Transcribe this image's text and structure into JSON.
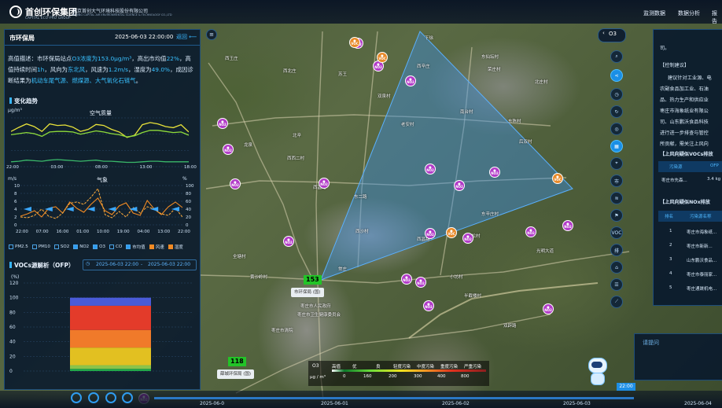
{
  "header": {
    "logo_text": "首创环保集团",
    "logo_sub": "CAPITAL ECO-PRO GROUP",
    "company_cn": "北京首创大气环境科技股份有限公司",
    "company_sub": "BEIJING CAPITAL AIR ENVIRONMENTAL SCIENCE & TECHNOLOGY CO.,LTD",
    "nav": [
      "监测数据",
      "数据分析",
      "报告"
    ]
  },
  "left_panel": {
    "title": "市环保局",
    "time": "2025-06-03 22:00:00",
    "back_label": "返回",
    "desc_parts": [
      "高值描述：市环保局站点",
      "O3浓度为153.0μg/m³",
      "，高出市均值",
      "22%",
      "，高值持续时间",
      "1h",
      "，风向为",
      "东北风",
      "，风速为",
      "1.2m/s",
      "，湿度为",
      "49.0%",
      "，成因诊断结果为",
      "机动车尾气源、燃煤源、大气氧化石链气",
      "。"
    ],
    "trend_title": "变化趋势",
    "aq_chart_title": "空气质量",
    "aq_unit": "μg/m³",
    "met_chart_title": "气象",
    "met_unit_left": "m/s",
    "met_unit_right": "%",
    "legend": [
      {
        "label": "PM2.5",
        "checked": false
      },
      {
        "label": "PM10",
        "checked": false
      },
      {
        "label": "SO2",
        "checked": false
      },
      {
        "label": "NO2",
        "checked": true
      },
      {
        "label": "O3",
        "checked": true
      },
      {
        "label": "CO",
        "checked": false
      },
      {
        "label": "市均值",
        "checked": true
      },
      {
        "label": "风速",
        "checked": true
      },
      {
        "label": "湿度",
        "checked": true
      }
    ],
    "vocs_title": "VOCs源解析（OFP）",
    "range_start": "2025-06-03 22:00",
    "range_sep": "-",
    "range_end": "2025-06-03 22:00",
    "vocs_unit": "(%)"
  },
  "chart_data": [
    {
      "type": "line",
      "title": "空气质量",
      "ylabel": "μg/m³",
      "x": [
        "22:00",
        "03:00",
        "08:00",
        "13:00",
        "18:00"
      ],
      "series": [
        {
          "values": [
            150,
            165,
            178,
            168,
            150,
            178,
            172,
            174,
            166,
            150,
            158,
            176,
            172,
            158,
            148,
            128,
            136,
            175,
            183,
            178,
            168,
            164,
            175,
            148
          ]
        },
        {
          "values": [
            138,
            142,
            146,
            142,
            132,
            148,
            150,
            150,
            148,
            140,
            146,
            152,
            148,
            142,
            138,
            130,
            134,
            146,
            154,
            154,
            150,
            146,
            148,
            136
          ]
        },
        {
          "values": [
            38,
            40,
            44,
            42,
            40,
            44,
            46,
            44,
            42,
            40,
            42,
            44,
            40,
            40,
            38,
            36,
            36,
            38,
            40,
            40,
            38,
            38,
            38,
            38
          ]
        }
      ]
    },
    {
      "type": "line",
      "title": "气象",
      "ylabel": "m/s",
      "x": [
        "22:00",
        "07:00",
        "16:00",
        "01:00",
        "10:00",
        "19:00",
        "04:00",
        "13:00",
        "22:00"
      ],
      "y_ticks_left": [
        0,
        2,
        4,
        6,
        8,
        10
      ],
      "y_ticks_right": [
        0,
        20,
        40,
        60,
        80,
        100
      ],
      "series": [
        {
          "name": "风速",
          "values": [
            2.2,
            2.8,
            3.6,
            2.0,
            4.2,
            4.6,
            3.0,
            5.8,
            4.2,
            3.2,
            5.2,
            6.8,
            3.6,
            2.6,
            4.8,
            5.6,
            3.0,
            2.4,
            6.2,
            4.0,
            2.6,
            4.6,
            5.8,
            4.4
          ]
        },
        {
          "name": "湿度",
          "values": [
            20,
            18,
            24,
            40,
            22,
            16,
            30,
            55,
            58,
            52,
            70,
            92,
            26,
            18,
            34,
            20,
            44,
            30,
            46,
            40,
            28,
            24,
            42,
            20
          ]
        }
      ]
    },
    {
      "type": "bar",
      "title": "VOCs源解析（OFP）",
      "ylabel": "(%)",
      "ylim": [
        0,
        120
      ],
      "y_ticks": [
        0,
        20,
        40,
        60,
        80,
        100,
        120
      ],
      "categories": [
        ""
      ],
      "series": [
        {
          "values": [
            3
          ]
        },
        {
          "values": [
            5
          ]
        },
        {
          "values": [
            24
          ]
        },
        {
          "values": [
            24
          ]
        },
        {
          "values": [
            33
          ]
        },
        {
          "values": [
            11
          ]
        }
      ],
      "colors": [
        "#22a84a",
        "#8bc34a",
        "#e2c021",
        "#f07a2a",
        "#e33b2a",
        "#4a5bd8"
      ]
    }
  ],
  "map": {
    "o3_selector": "O3",
    "station_main_value": "153",
    "station_main_label": "市环保局 (国)",
    "station_2_value": "118",
    "station_2_label": "薛城环保局 (国)",
    "conc_legend_pollutant": "O3",
    "conc_legend_unit": "μg / m³",
    "conc_levels": [
      "高值",
      "优",
      "良",
      "轻度污染",
      "中度污染",
      "重度污染",
      "严重污染"
    ],
    "conc_ticks": [
      "0",
      "160",
      "200",
      "300",
      "400",
      "800"
    ],
    "places": [
      "西王庄",
      "西北庄",
      "苏王",
      "下徐",
      "东仙坛村",
      "西辛庄",
      "荣庄村",
      "双泉村",
      "老安村",
      "南台村",
      "后双村",
      "龙泉",
      "北辛",
      "西西二村",
      "东陈村",
      "东辛庄村",
      "枣庄市人民政府",
      "枣庄市卫生健康委员会",
      "光明大道",
      "西昌路",
      "东二路",
      "西昌路",
      "小坊村",
      "黄沙岭村",
      "枣庄市清院",
      "双辟路",
      "全塘村",
      "西沙村",
      "小松村",
      "半截楼村",
      "常庄",
      "北庄村"
    ],
    "markers_no2": 20,
    "markers_voc": 4
  },
  "right_panel": {
    "intro_line": "司。",
    "control_title": "【控制建议】",
    "control_lines": [
      "建议针对工业源、电",
      "农副食品加工业、石油",
      "品、热力生产和供应业",
      "枣庄市海象纸业有限公",
      "司、山东鹏沃食品科技",
      "进行进一步排查与管控",
      "所贡献，需关注上风向"
    ],
    "voc_table_title": "【上风向疑似VOCs排放",
    "voc_cols": [
      "污染源",
      "OFP"
    ],
    "voc_row_name": "枣庄市先森...",
    "voc_row_val": "3.4 kg",
    "nox_table_title": "【上风向疑似NOx排放",
    "nox_cols": [
      "排名",
      "污染源名称"
    ],
    "nox_rows": [
      {
        "rank": "1",
        "name": "枣庄市海象纸..."
      },
      {
        "rank": "2",
        "name": "枣庄市新新..."
      },
      {
        "rank": "3",
        "name": "山东鹏沃食品..."
      },
      {
        "rank": "4",
        "name": "枣庄市泰丽家..."
      },
      {
        "rank": "5",
        "name": "枣庄通晟机电..."
      }
    ]
  },
  "chat": {
    "placeholder": "请提问"
  },
  "toolbar": {
    "items": [
      "search-icon",
      "share-icon",
      "clock-icon",
      "refresh-icon",
      "target-icon",
      "layers-icon",
      "location-icon",
      "城",
      "市",
      "wind-icon",
      "flag-icon",
      "VOC",
      "排",
      "home-icon",
      "list-icon",
      "ruler-icon"
    ],
    "labels": {
      "city": "城",
      "shi": "市",
      "voc": "VOC",
      "pai": "排"
    }
  },
  "timeline": {
    "time_badge": "22:00",
    "dates": [
      "2025-06-01",
      "2025-06-02",
      "2025-06-03",
      "2025-06-04"
    ],
    "date_left_partial": "2025-06-0"
  }
}
